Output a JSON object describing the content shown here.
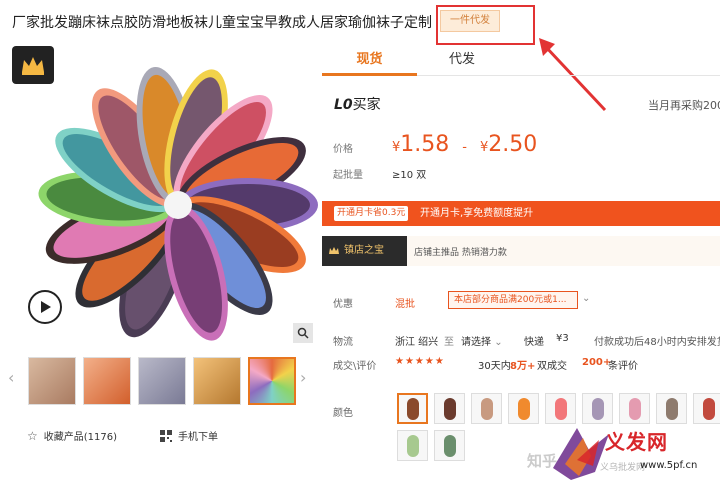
{
  "title": "厂家批发蹦床袜点胶防滑地板袜儿童宝宝早教成人居家瑜伽袜子定制",
  "badge": "一件代发",
  "gallery": {
    "thumbnails": [
      {
        "name": "thumb-1",
        "color": "#c9a58b"
      },
      {
        "name": "thumb-2",
        "color": "#e78a59"
      },
      {
        "name": "thumb-3",
        "color": "#8f8fa8"
      },
      {
        "name": "thumb-4",
        "color": "#d39a52"
      },
      {
        "name": "thumb-5",
        "color": "#e56a3f"
      }
    ]
  },
  "actions": {
    "favorite": "收藏产品(1176)",
    "mobile_order": "手机下单"
  },
  "tabs": [
    "现货",
    "代发"
  ],
  "seller": {
    "prefix": "L0",
    "name": "买家",
    "repeat_buyers": "当月再采购200"
  },
  "price": {
    "label": "价格",
    "currency": "¥",
    "low": "1.58",
    "sep": "-",
    "high": "2.50",
    "min_label": "起批量",
    "min_value": "≥10 双"
  },
  "promo": {
    "chip": "开通月卡省0.3元",
    "text": "开通月卡,享免费额度提升"
  },
  "shop": {
    "badge": "镇店之宝",
    "text": "店铺主推品   热销潜力款"
  },
  "coupon": {
    "label": "优惠",
    "tag": "混批",
    "box": "本店部分商品满200元或1...",
    "arrow": "⌄"
  },
  "logistics": {
    "label": "物流",
    "origin": "浙江 绍兴",
    "to": "至",
    "dest": "请选择",
    "courier": "快递",
    "fee": "¥3",
    "dispatch": "付款成功后48小时内安排发货"
  },
  "reviews": {
    "label": "成交\\评价",
    "stars": "★★★★★",
    "period": "30天内",
    "deals": "8万+",
    "deals_suffix": "双成交",
    "count": "200+",
    "count_suffix": "条评价"
  },
  "colors": {
    "label": "颜色",
    "swatches": [
      "#8a4a2c",
      "#6b3b2e",
      "#c89a80",
      "#f08a2e",
      "#f2777a",
      "#a596b5",
      "#e49bb0",
      "#8e7b6e",
      "#c24a3e",
      "#a7c98f",
      "#6b8f6d"
    ]
  },
  "watermark": {
    "zhihu": "知乎",
    "brand_cn": "义发网",
    "sub": "义乌批发网",
    "url": "www.5pf.cn"
  }
}
